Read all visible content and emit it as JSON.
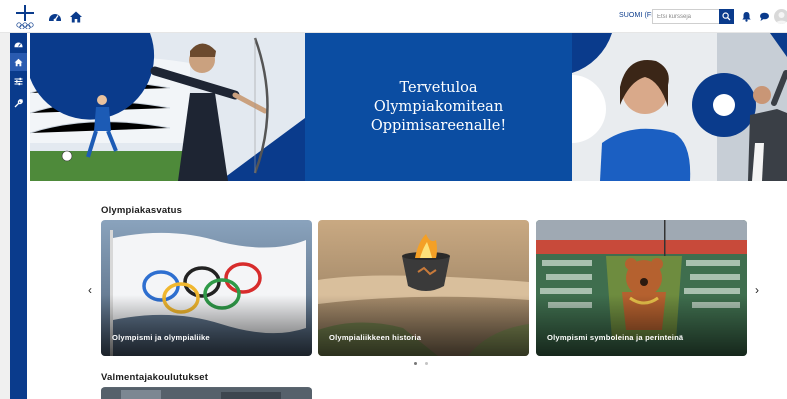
{
  "header": {
    "language": "SUOMI (FI)",
    "search_placeholder": "Etsi kursseja"
  },
  "hero": {
    "title": "Tervetuloa Olympiakomitean Oppimisareenalle!"
  },
  "sections": [
    {
      "title": "Olympiakasvatus",
      "cards": [
        {
          "caption": "Olympismi ja olympialiike"
        },
        {
          "caption": "Olympialiikkeen historia"
        },
        {
          "caption": "Olympismi symboleina ja perinteinä"
        }
      ]
    },
    {
      "title": "Valmentajakoulutukset"
    }
  ],
  "carousel": {
    "prev_symbol": "‹",
    "next_symbol": "›",
    "pages": 2,
    "active_page": 1
  },
  "colors": {
    "brand": "#0a3b8c",
    "hero_panel": "#0b4da2"
  }
}
